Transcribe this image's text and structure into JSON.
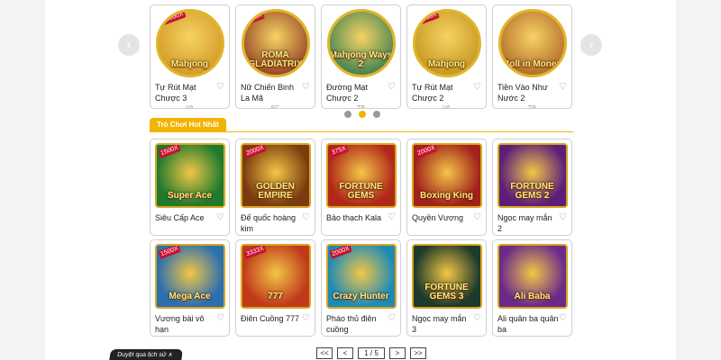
{
  "carousel": {
    "prev_label": "‹",
    "next_label": "›",
    "items": [
      {
        "title": "Tự Rút Mạt Chược 3",
        "provider": "VA",
        "art": "Mahjong",
        "badge": "10000X"
      },
      {
        "title": "Nữ Chiến Binh La Mã",
        "provider": "FC",
        "art": "ROMA GLADIATRIX",
        "badge": "200X"
      },
      {
        "title": "Đường Mạt Chược 2",
        "provider": "TP",
        "art": "Mahjong Ways 2",
        "badge": ""
      },
      {
        "title": "Tự Rút Mạt Chược 2",
        "provider": "VA",
        "art": "Mahjong",
        "badge": "8000X"
      },
      {
        "title": "Tiền Vào Như Nước 2",
        "provider": "TP",
        "art": "Roll in Money",
        "badge": ""
      }
    ],
    "dots": [
      {
        "active": false
      },
      {
        "active": true
      },
      {
        "active": false
      }
    ]
  },
  "section": {
    "title": "Trò Chơi Hot Nhất"
  },
  "hot_games": [
    {
      "title": "Siêu Cấp Ace",
      "art": "Super Ace",
      "badge": "1500X",
      "bg": "#1f7a2e"
    },
    {
      "title": "Đế quốc hoàng kim",
      "art": "GOLDEN EMPIRE",
      "badge": "2000X",
      "bg": "#7a3c0f"
    },
    {
      "title": "Bảo thạch Kala",
      "art": "FORTUNE GEMS",
      "badge": "375X",
      "bg": "#b0281a"
    },
    {
      "title": "Quyền Vương",
      "art": "Boxing King",
      "badge": "2000X",
      "bg": "#a3211b"
    },
    {
      "title": "Ngọc may mắn 2",
      "art": "FORTUNE GEMS 2",
      "badge": "",
      "bg": "#5b1f7a"
    },
    {
      "title": "Vương bài vô hạn",
      "art": "Mega Ace",
      "badge": "1500X",
      "bg": "#2a6fb0"
    },
    {
      "title": "Điên Cuồng 777",
      "art": "777",
      "badge": "3333X",
      "bg": "#c0391b"
    },
    {
      "title": "Pháo thủ điên cuồng",
      "art": "Crazy Hunter",
      "badge": "2000X",
      "bg": "#1e8bb5"
    },
    {
      "title": "Ngọc may mắn 3",
      "art": "FORTUNE GEMS 3",
      "badge": "",
      "bg": "#1d3a2a"
    },
    {
      "title": "Ali quân ba quân ba",
      "art": "Ali Baba",
      "badge": "",
      "bg": "#6a2a8a"
    }
  ],
  "pagination": {
    "first": "<<",
    "prev": "<",
    "current": "1 / 5",
    "next": ">",
    "last": ">>"
  },
  "history_tab": {
    "label": "Duyệt qua lịch sử ∧"
  },
  "colors": {
    "accent": "#f2b400",
    "card_border": "#cfcfcf",
    "background": "#f3f3f3"
  }
}
